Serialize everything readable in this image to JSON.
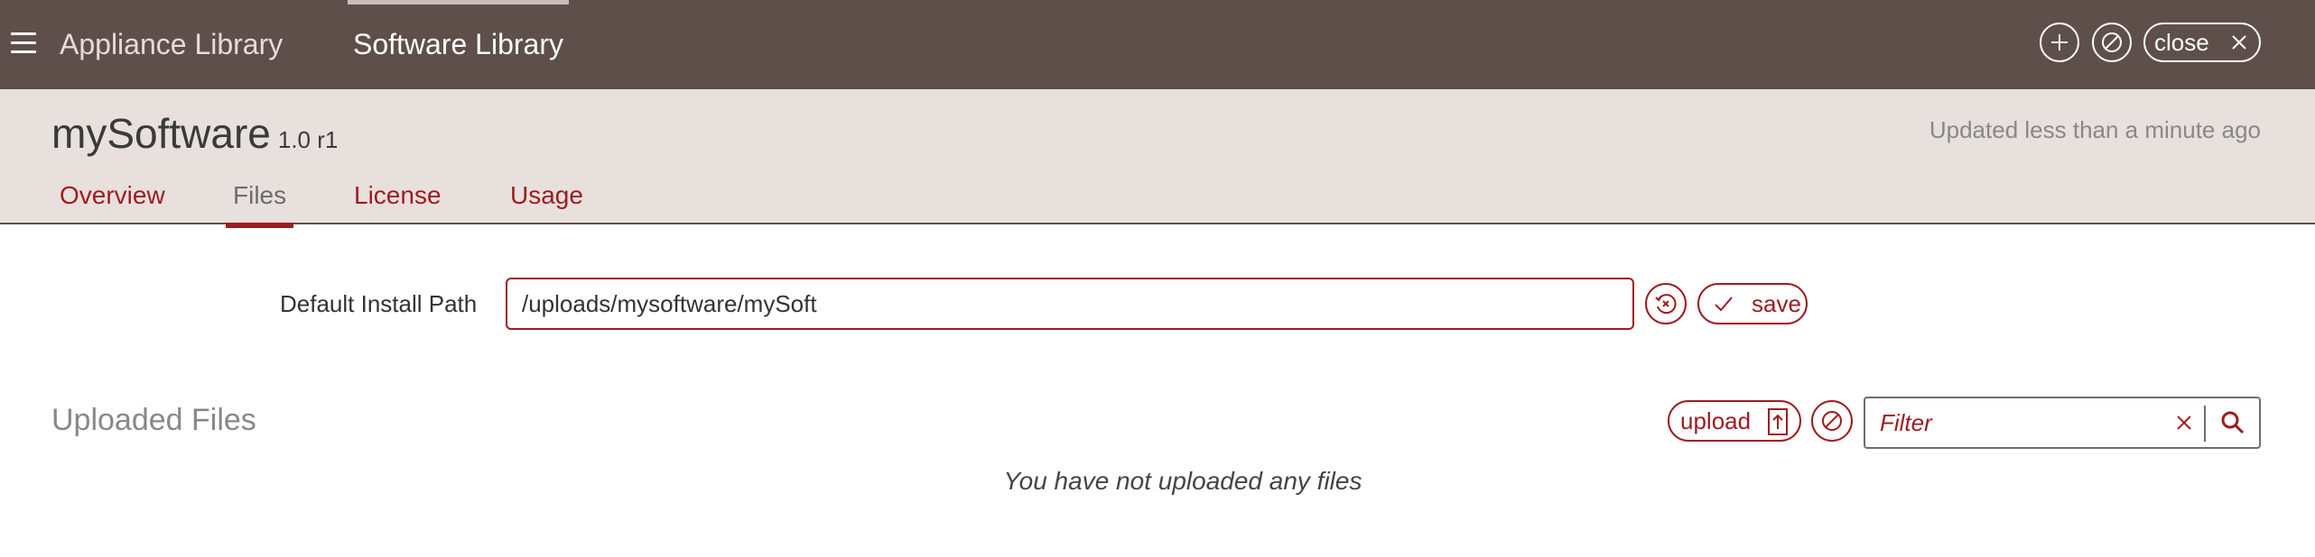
{
  "topbar": {
    "nav": [
      {
        "label": "Appliance Library",
        "active": false
      },
      {
        "label": "Software Library",
        "active": true
      }
    ],
    "actions": {
      "add_icon": "plus-icon",
      "cancel_icon": "ban-icon",
      "close_label": "close"
    }
  },
  "header": {
    "title": "mySoftware",
    "version": "1.0 r1",
    "updated": "Updated less than a minute ago",
    "tabs": [
      {
        "label": "Overview",
        "active": false
      },
      {
        "label": "Files",
        "active": true
      },
      {
        "label": "License",
        "active": false
      },
      {
        "label": "Usage",
        "active": false
      }
    ]
  },
  "install": {
    "label": "Default Install Path",
    "value": "/uploads/mysoftware/mySoft",
    "save_label": "save"
  },
  "files": {
    "title": "Uploaded Files",
    "upload_label": "upload",
    "filter_placeholder": "Filter",
    "empty_message": "You have not uploaded any files"
  },
  "colors": {
    "topbar": "#5f4f4b",
    "header_band": "#e8e0dd",
    "accent": "#9e1b1f"
  }
}
